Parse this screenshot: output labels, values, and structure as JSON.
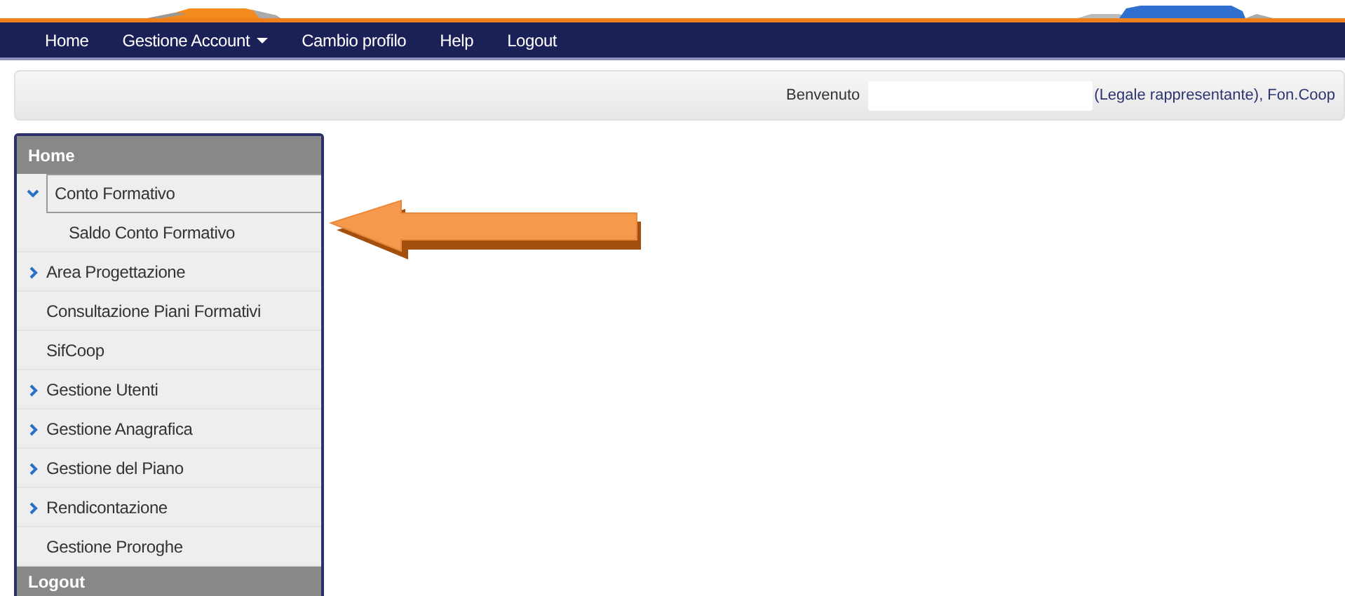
{
  "navbar": {
    "items": [
      {
        "label": "Home",
        "dropdown": false
      },
      {
        "label": "Gestione Account",
        "dropdown": true
      },
      {
        "label": "Cambio profilo",
        "dropdown": false
      },
      {
        "label": "Help",
        "dropdown": false
      },
      {
        "label": "Logout",
        "dropdown": false
      }
    ]
  },
  "welcome_bar": {
    "greeting": "Benvenuto",
    "role": "(Legale rappresentante), Fon.Coop"
  },
  "sidebar": {
    "header": "Home",
    "items": [
      {
        "label": "Conto Formativo",
        "kind": "group",
        "expanded": true,
        "selected": true,
        "children": [
          {
            "label": "Saldo Conto Formativo",
            "selected": false
          }
        ]
      },
      {
        "label": "Area Progettazione",
        "kind": "group",
        "expanded": false,
        "selected": false
      },
      {
        "label": "Consultazione Piani Formativi",
        "kind": "link",
        "selected": false
      },
      {
        "label": "SifCoop",
        "kind": "link",
        "selected": false
      },
      {
        "label": "Gestione Utenti",
        "kind": "group",
        "expanded": false,
        "selected": false
      },
      {
        "label": "Gestione Anagrafica",
        "kind": "group",
        "expanded": false,
        "selected": false
      },
      {
        "label": "Gestione del Piano",
        "kind": "group",
        "expanded": false,
        "selected": false
      },
      {
        "label": "Rendicontazione",
        "kind": "group",
        "expanded": false,
        "selected": false
      },
      {
        "label": "Gestione Proroghe",
        "kind": "link",
        "selected": false
      }
    ],
    "footer": "Logout"
  }
}
